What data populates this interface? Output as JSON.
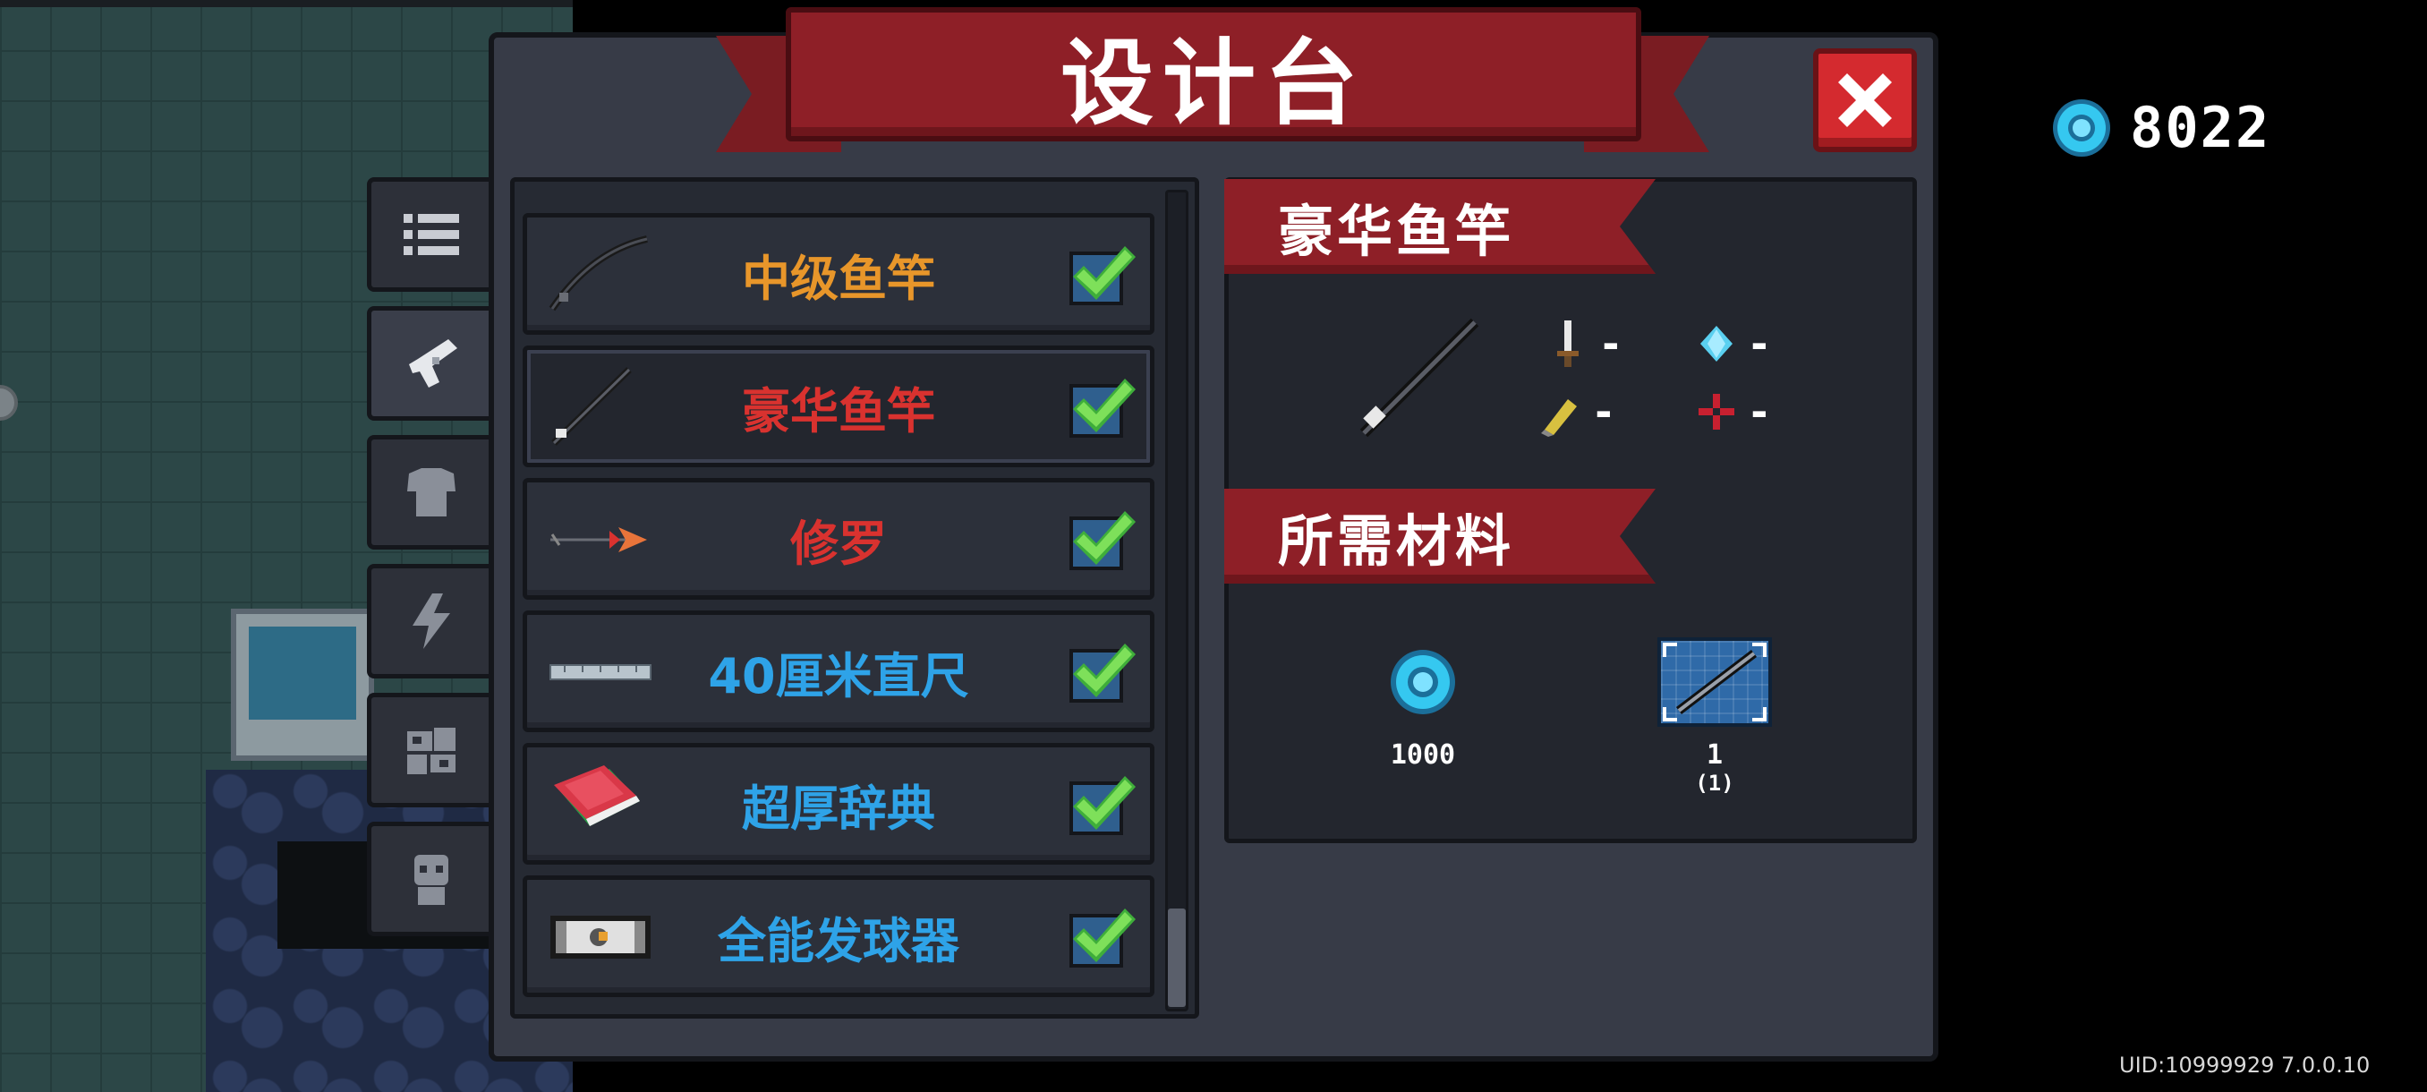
{
  "title": "设计台",
  "currency": {
    "amount": "8022",
    "color": "#35c8f0"
  },
  "tabs": [
    {
      "name": "list-icon",
      "active": false
    },
    {
      "name": "gun-icon",
      "active": true
    },
    {
      "name": "armor-icon",
      "active": false
    },
    {
      "name": "lightning-icon",
      "active": false
    },
    {
      "name": "gears-icon",
      "active": false
    },
    {
      "name": "character-icon",
      "active": false
    }
  ],
  "items": [
    {
      "label": "中级鱼竿",
      "color": "#e8962a",
      "checked": true,
      "icon": "fishing-rod-icon"
    },
    {
      "label": "豪华鱼竿",
      "color": "#d9322f",
      "checked": true,
      "icon": "luxury-fishing-rod-icon"
    },
    {
      "label": "修罗",
      "color": "#d9322f",
      "checked": true,
      "icon": "arrow-icon"
    },
    {
      "label": "40厘米直尺",
      "color": "#2ea3e8",
      "checked": true,
      "icon": "ruler-icon"
    },
    {
      "label": "超厚辞典",
      "color": "#2ea3e8",
      "checked": true,
      "icon": "dictionary-icon"
    },
    {
      "label": "全能发球器",
      "color": "#2ea3e8",
      "checked": true,
      "icon": "ball-launcher-icon"
    }
  ],
  "detail": {
    "name": "豪华鱼竿",
    "stats": {
      "damage": "-",
      "energy": "-",
      "crit": "-",
      "accuracy": "-"
    },
    "materials_title": "所需材料",
    "materials": [
      {
        "type": "gem",
        "qty": "1000",
        "sub": ""
      },
      {
        "type": "blueprint",
        "qty": "1",
        "sub": "(1)"
      }
    ]
  },
  "uid": "UID:10999929 7.0.0.10"
}
